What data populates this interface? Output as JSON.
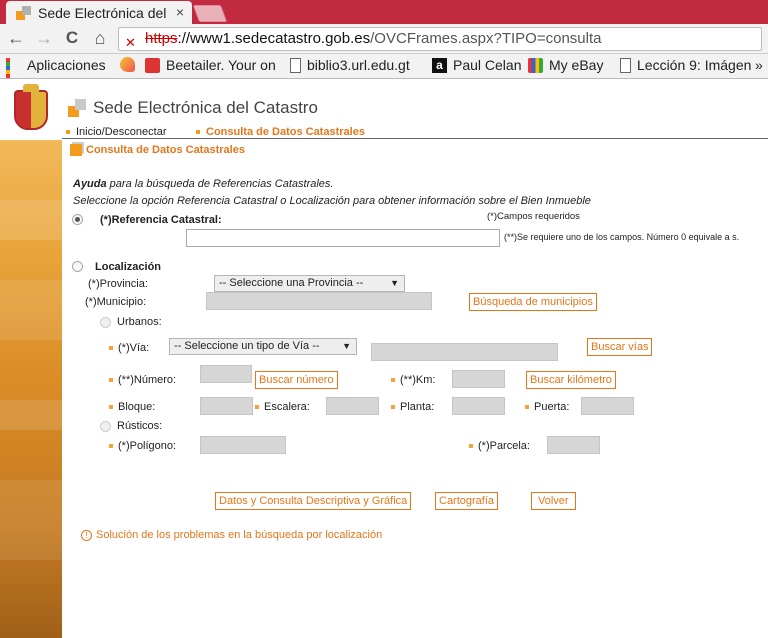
{
  "browser": {
    "tab_title": "Sede Electrónica del",
    "tab_close": "×",
    "url_scheme": "https",
    "url_rest": "://www1.sedecatastro.gob.es",
    "url_path": "/OVCFrames.aspx?TIPO=consulta",
    "nav_back": "←",
    "nav_forward": "→",
    "nav_reload": "C",
    "nav_home": "⌂",
    "bookmarks": [
      {
        "label": "Aplicaciones",
        "icon": "apps-icon"
      },
      {
        "label": "",
        "icon": "lemon-icon"
      },
      {
        "label": "Beetailer. Your on",
        "icon": "gift-icon"
      },
      {
        "label": "biblio3.url.edu.gt",
        "icon": "page-icon"
      },
      {
        "label": "Paul Celan",
        "icon": "amazon-icon"
      },
      {
        "label": "My eBay",
        "icon": "ebay-icon"
      },
      {
        "label": "Lección 9: Imágen",
        "icon": "page-icon"
      }
    ],
    "overflow": "»"
  },
  "site": {
    "title": "Sede Electrónica del Catastro",
    "nav": {
      "home": "Inicio/Desconectar",
      "current": "Consulta de Datos Catastrales"
    },
    "section_title": "Consulta de Datos Catastrales"
  },
  "form": {
    "help_bold": "Ayuda",
    "help_rest": " para la búsqueda de Referencias Catastrales.",
    "instruction": "Seleccione la opción Referencia Catastral o Localización para obtener información sobre el Bien Inmueble",
    "required_note": "(*)Campos requeridos",
    "ref_label": "(*)Referencia Catastral:",
    "ref_value": "",
    "ref_note": "(**)Se requiere uno de los campos. Número 0 equivale a s.",
    "loc_label": "Localización",
    "provincia_label": "(*)Provincia:",
    "provincia_select": "-- Seleccione una Provincia --",
    "municipio_label": "(*)Municipio:",
    "buscar_municipios": "Búsqueda de municipios",
    "urbanos_label": "Urbanos:",
    "via_label": "(*)Vía:",
    "via_select": "-- Seleccione un tipo de Vía --",
    "buscar_vias": "Buscar vías",
    "numero_label": "(**)Número:",
    "buscar_numero": "Buscar número",
    "km_label": "(**)Km:",
    "buscar_km": "Buscar kilómetro",
    "bloque_label": "Bloque:",
    "escalera_label": "Escalera:",
    "planta_label": "Planta:",
    "puerta_label": "Puerta:",
    "rusticos_label": "Rústicos:",
    "poligono_label": "(*)Polígono:",
    "parcela_label": "(*)Parcela:",
    "btn_datos": "Datos y Consulta Descriptiva y Gráfica",
    "btn_cartografia": "Cartografía",
    "btn_volver": "Volver",
    "help_link": "Solución de los problemas en la búsqueda por localización",
    "selected_option": "Referencia Catastral"
  },
  "colors": {
    "accent": "#e4761b",
    "chrome_tabstrip": "#c22b3f"
  }
}
